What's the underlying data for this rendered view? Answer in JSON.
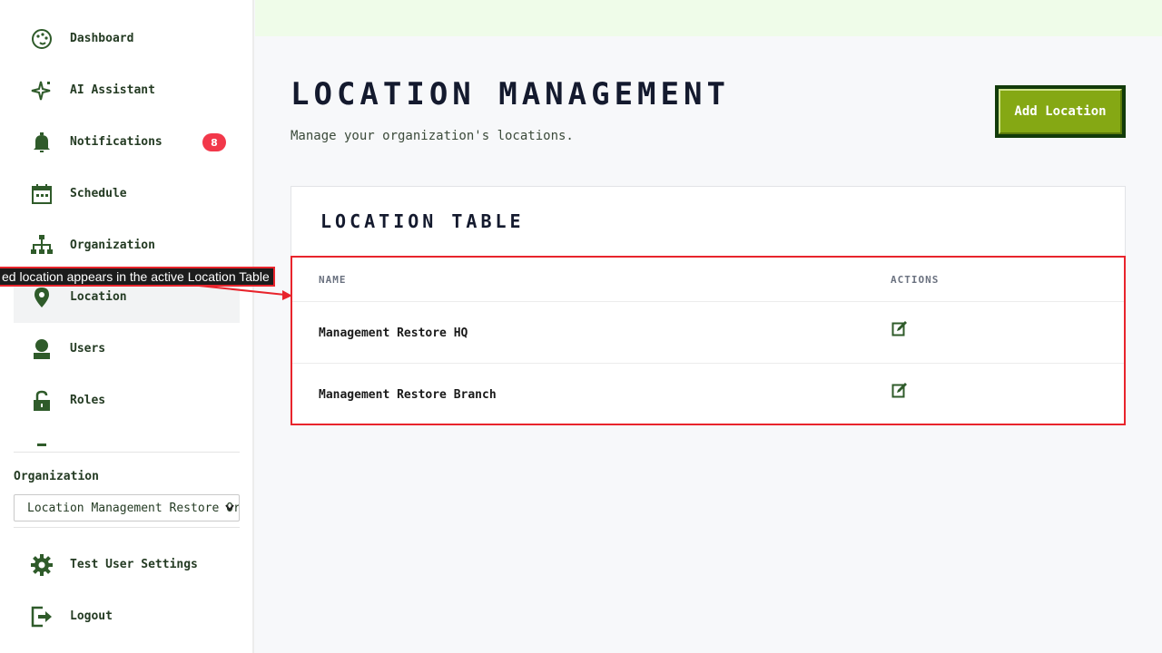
{
  "sidebar": {
    "items": [
      {
        "label": "Dashboard",
        "icon": "palette-icon"
      },
      {
        "label": "AI Assistant",
        "icon": "sparkle-icon"
      },
      {
        "label": "Notifications",
        "icon": "bell-icon",
        "badge": "8"
      },
      {
        "label": "Schedule",
        "icon": "calendar-icon"
      },
      {
        "label": "Organization",
        "icon": "org-chart-icon"
      },
      {
        "label": "Location",
        "icon": "map-pin-icon",
        "active": true
      },
      {
        "label": "Users",
        "icon": "user-icon"
      },
      {
        "label": "Roles",
        "icon": "lock-icon"
      }
    ],
    "organization_label": "Organization",
    "organization_selected": "Location Management Restore Org",
    "bottom_items": [
      {
        "label": "Test User Settings",
        "icon": "gear-icon"
      },
      {
        "label": "Logout",
        "icon": "logout-icon"
      }
    ]
  },
  "main": {
    "title": "LOCATION MANAGEMENT",
    "subtitle": "Manage your organization's locations.",
    "add_button": "Add Location",
    "card_title": "LOCATION TABLE",
    "table": {
      "headers": [
        "NAME",
        "ACTIONS"
      ],
      "rows": [
        {
          "name": "Management Restore HQ"
        },
        {
          "name": "Management Restore Branch"
        }
      ]
    }
  },
  "annotation": {
    "text": "ed location appears in the active Location Table"
  },
  "colors": {
    "accent_green": "#85a814",
    "dark_green": "#123b0a",
    "icon_green": "#2f5b2a",
    "badge_red": "#f2384a",
    "highlight_red": "#e8242c",
    "topbar": "#effce9"
  }
}
